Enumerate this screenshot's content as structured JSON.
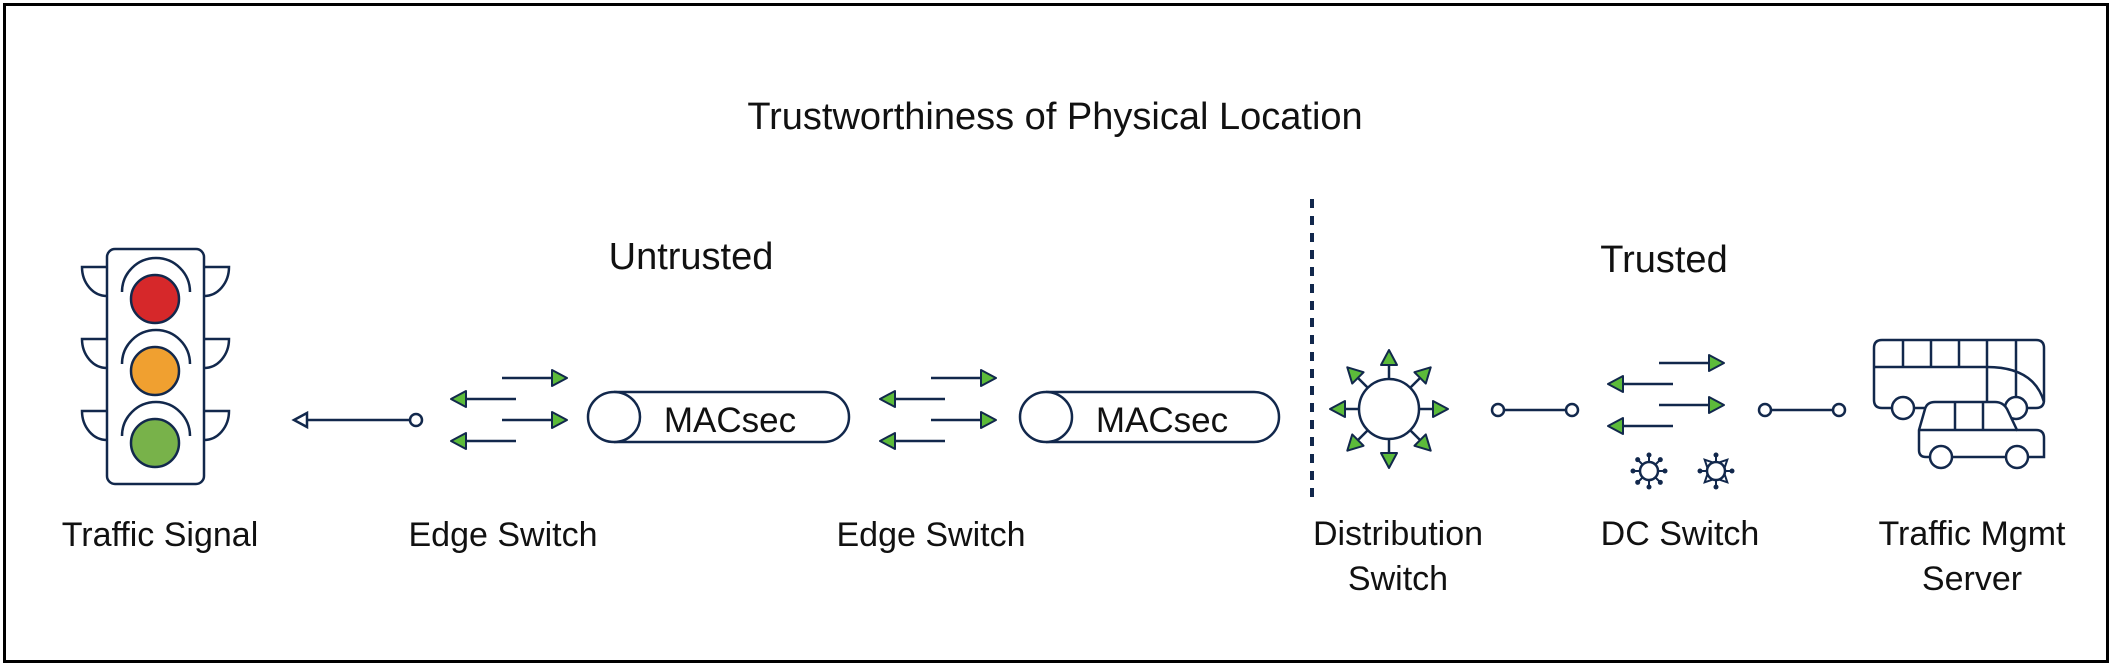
{
  "title": "Trustworthiness of Physical Location",
  "colors": {
    "title": "#78b24a",
    "untrusted": "#d6282a",
    "trusted": "#78b24a",
    "stroke": "#12284c",
    "arrow_fill": "#5cbb3a",
    "light_red": "#d6282a",
    "light_amber": "#f0a030",
    "light_green": "#78b24a",
    "text": "#111111"
  },
  "zones": {
    "untrusted": "Untrusted",
    "trusted": "Trusted"
  },
  "nodes": [
    {
      "id": "traffic-signal",
      "label": [
        "Traffic Signal"
      ],
      "icon": "traffic-light-icon"
    },
    {
      "id": "edge-switch-1",
      "label": [
        "Edge Switch"
      ],
      "icon": "switch-icon"
    },
    {
      "id": "edge-switch-2",
      "label": [
        "Edge Switch"
      ],
      "icon": "switch-icon"
    },
    {
      "id": "distribution-switch",
      "label": [
        "Distribution",
        "Switch"
      ],
      "icon": "distribution-switch-icon"
    },
    {
      "id": "dc-switch",
      "label": [
        "DC Switch"
      ],
      "icon": "dc-switch-icon"
    },
    {
      "id": "traffic-mgmt-server",
      "label": [
        "Traffic Mgmt",
        "Server"
      ],
      "icon": "bus-car-icon"
    }
  ],
  "links": [
    {
      "from": "traffic-signal",
      "to": "edge-switch-1",
      "type": "arrow-to-signal"
    },
    {
      "from": "edge-switch-1",
      "to": "edge-switch-2",
      "type": "tunnel",
      "label": "MACsec"
    },
    {
      "from": "edge-switch-2",
      "to": "distribution-switch",
      "type": "tunnel",
      "label": "MACsec"
    },
    {
      "from": "distribution-switch",
      "to": "dc-switch",
      "type": "line"
    },
    {
      "from": "dc-switch",
      "to": "traffic-mgmt-server",
      "type": "line"
    }
  ]
}
